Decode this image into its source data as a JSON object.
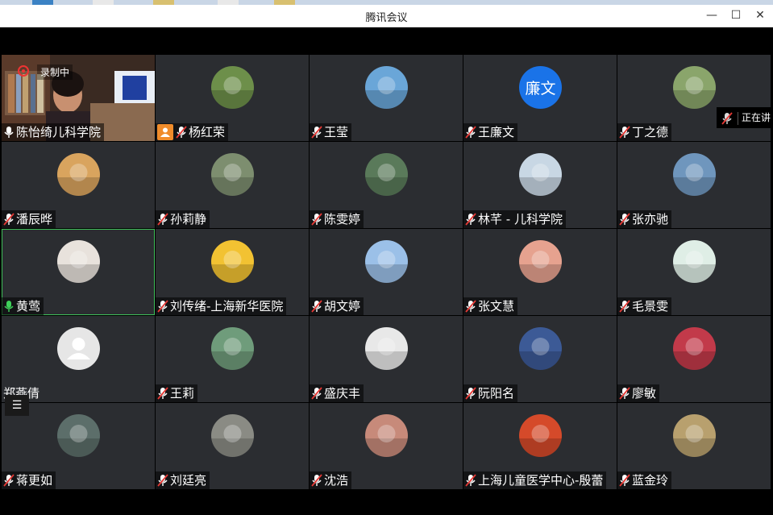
{
  "window": {
    "title": "腾讯会议"
  },
  "recording": {
    "label": "录制中"
  },
  "speaking_panel": {
    "label": "正在讲"
  },
  "participants": [
    {
      "name": "陈怡绮儿科学院",
      "mic": "on",
      "type": "video"
    },
    {
      "name": "杨红荣",
      "mic": "muted",
      "type": "avatar",
      "avatar_icon": "flower-photo",
      "color": "#6d8f4a",
      "user_badge": true
    },
    {
      "name": "王莹",
      "mic": "muted",
      "type": "avatar",
      "avatar_icon": "city-skyline-photo",
      "color": "#6aa6d8"
    },
    {
      "name": "王廉文",
      "mic": "muted",
      "type": "initials",
      "initials": "廉文",
      "color": "#1a73e8"
    },
    {
      "name": "丁之德",
      "mic": "muted",
      "type": "avatar",
      "avatar_icon": "stonehenge-photo",
      "color": "#8aa56b"
    },
    {
      "name": "潘辰晔",
      "mic": "muted",
      "type": "avatar",
      "avatar_icon": "cat-photo",
      "color": "#d9a45e"
    },
    {
      "name": "孙莉静",
      "mic": "muted",
      "type": "avatar",
      "avatar_icon": "pine-tree-photo",
      "color": "#7d8e6f"
    },
    {
      "name": "陈雯婷",
      "mic": "muted",
      "type": "avatar",
      "avatar_icon": "character-photo",
      "color": "#5a7a5a"
    },
    {
      "name": "林芊 - 儿科学院",
      "mic": "muted",
      "type": "avatar",
      "avatar_icon": "red-berries-photo",
      "color": "#c8d7e4"
    },
    {
      "name": "张亦驰",
      "mic": "muted",
      "type": "avatar",
      "avatar_icon": "sky-clouds-photo",
      "color": "#6f96bd"
    },
    {
      "name": "黄莺",
      "mic": "speaking",
      "type": "avatar",
      "avatar_icon": "red-toy-photo",
      "color": "#e8e2dc",
      "active": true
    },
    {
      "name": "刘传绪-上海新华医院",
      "mic": "muted",
      "type": "avatar",
      "avatar_icon": "cartoon-photo",
      "color": "#f2c232"
    },
    {
      "name": "胡文婷",
      "mic": "muted",
      "type": "avatar",
      "avatar_icon": "blossom-tree-photo",
      "color": "#9bc0e8"
    },
    {
      "name": "张文慧",
      "mic": "muted",
      "type": "avatar",
      "avatar_icon": "autumn-painting-photo",
      "color": "#e6a28f"
    },
    {
      "name": "毛景雯",
      "mic": "muted",
      "type": "avatar",
      "avatar_icon": "sketch-photo",
      "color": "#dfeee6"
    },
    {
      "name": "郑燕倩",
      "mic": "none",
      "type": "default",
      "avatar_icon": "default-user-icon",
      "color": "#e6e6e6"
    },
    {
      "name": "王莉",
      "mic": "muted",
      "type": "avatar",
      "avatar_icon": "woman-garden-photo",
      "color": "#6f9c7b"
    },
    {
      "name": "盛庆丰",
      "mic": "muted",
      "type": "avatar",
      "avatar_icon": "man-portrait-photo",
      "color": "#e8e8e8"
    },
    {
      "name": "阮阳名",
      "mic": "muted",
      "type": "avatar",
      "avatar_icon": "guitarist-photo",
      "color": "#3c5a96"
    },
    {
      "name": "廖敏",
      "mic": "muted",
      "type": "avatar",
      "avatar_icon": "pikachu-photo",
      "color": "#c23a4a"
    },
    {
      "name": "蒋更如",
      "mic": "muted",
      "type": "avatar",
      "avatar_icon": "river-landscape-photo",
      "color": "#5c6e6a"
    },
    {
      "name": "刘廷亮",
      "mic": "muted",
      "type": "avatar",
      "avatar_icon": "statue-photo",
      "color": "#8a8b84"
    },
    {
      "name": "沈浩",
      "mic": "muted",
      "type": "avatar",
      "avatar_icon": "dolphin-photo",
      "color": "#c78a7a"
    },
    {
      "name": "上海儿童医学中心-殷蕾",
      "mic": "muted",
      "type": "avatar",
      "avatar_icon": "red-tree-photo",
      "color": "#d54a2a"
    },
    {
      "name": "蓝金玲",
      "mic": "muted",
      "type": "avatar",
      "avatar_icon": "puppy-photo",
      "color": "#b8a06e"
    }
  ]
}
